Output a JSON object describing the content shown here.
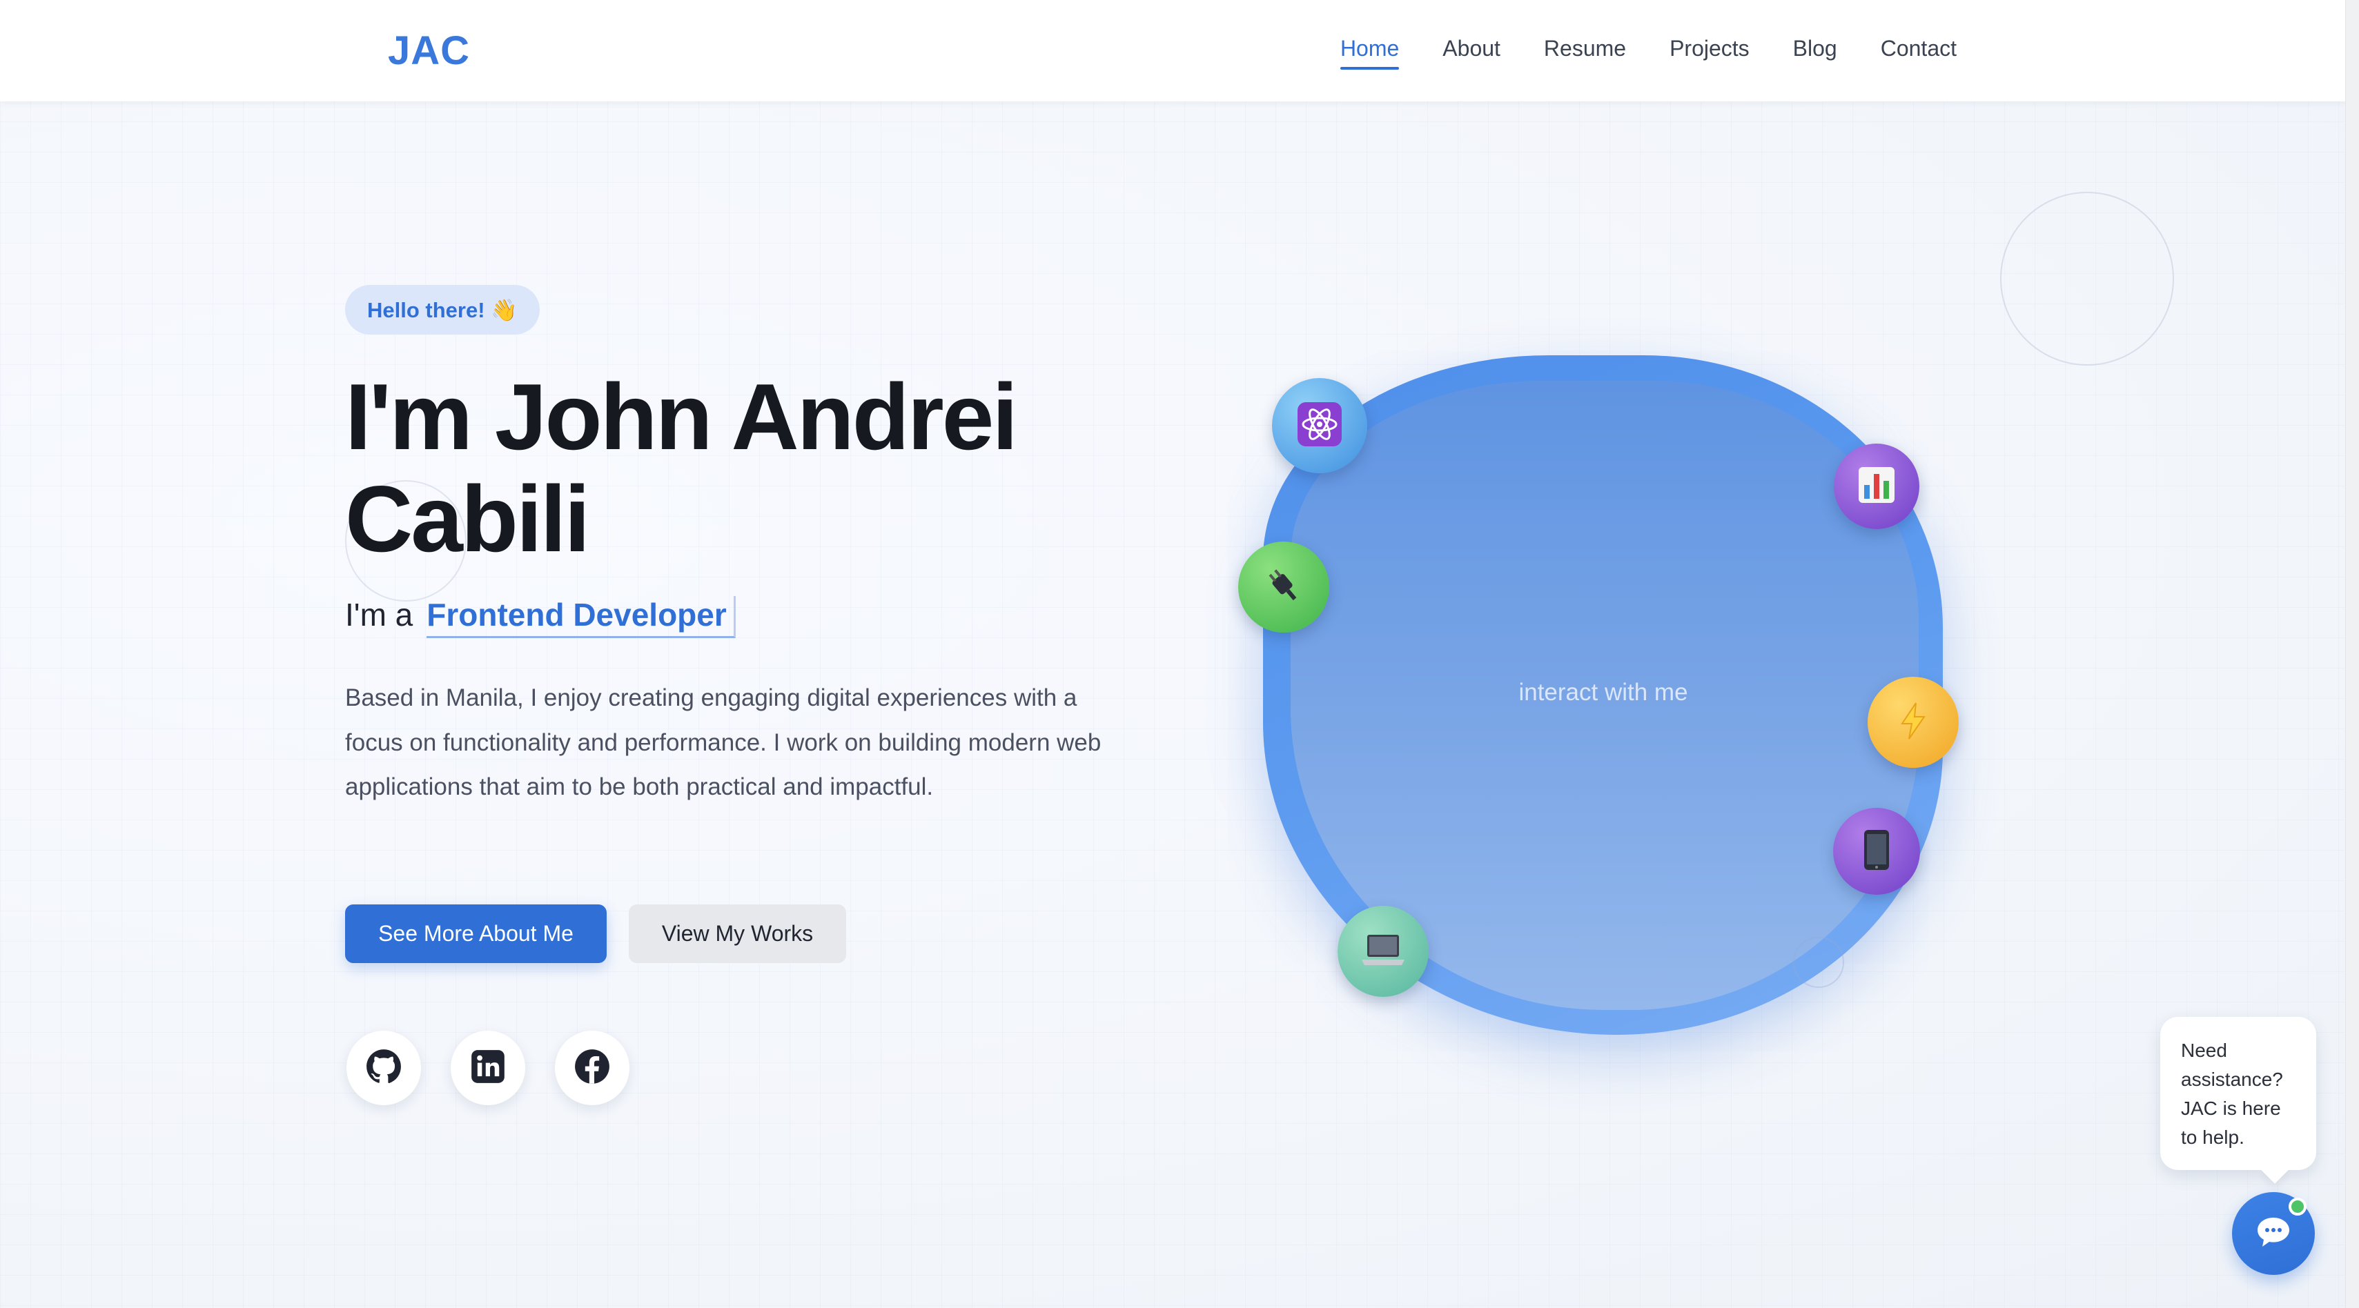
{
  "nav": {
    "logo": "JAC",
    "links": [
      {
        "label": "Home",
        "active": true
      },
      {
        "label": "About",
        "active": false
      },
      {
        "label": "Resume",
        "active": false
      },
      {
        "label": "Projects",
        "active": false
      },
      {
        "label": "Blog",
        "active": false
      },
      {
        "label": "Contact",
        "active": false
      }
    ]
  },
  "hero": {
    "greeting": "Hello there! 👋",
    "name_line1": "I'm John Andrei",
    "name_line2": "Cabili",
    "role_prefix": "I'm a",
    "role_title": "Frontend Developer",
    "bio": "Based in Manila, I enjoy creating engaging digital experiences with a focus on functionality and performance. I work on building modern web applications that aim to be both practical and impactful.",
    "primary_button": "See More About Me",
    "secondary_button": "View My Works",
    "socials": [
      {
        "icon": "github-icon"
      },
      {
        "icon": "linkedin-icon"
      },
      {
        "icon": "facebook-icon"
      }
    ]
  },
  "showcase": {
    "prompt": "interact with me",
    "orbs": [
      {
        "icon": "react-icon",
        "glyph": "⚛"
      },
      {
        "icon": "plug-icon",
        "glyph": "🔌"
      },
      {
        "icon": "bar-chart-icon",
        "glyph": "📊"
      },
      {
        "icon": "lightning-icon",
        "glyph": "⚡"
      },
      {
        "icon": "mobile-phone-icon",
        "glyph": "📱"
      },
      {
        "icon": "laptop-icon",
        "glyph": "💻"
      }
    ]
  },
  "chat": {
    "message": "Need assistance? JAC is here to help.",
    "status": "online"
  },
  "colors": {
    "accent": "#2f6fd6",
    "logo": "#3a78dc",
    "online": "#4cc467"
  }
}
